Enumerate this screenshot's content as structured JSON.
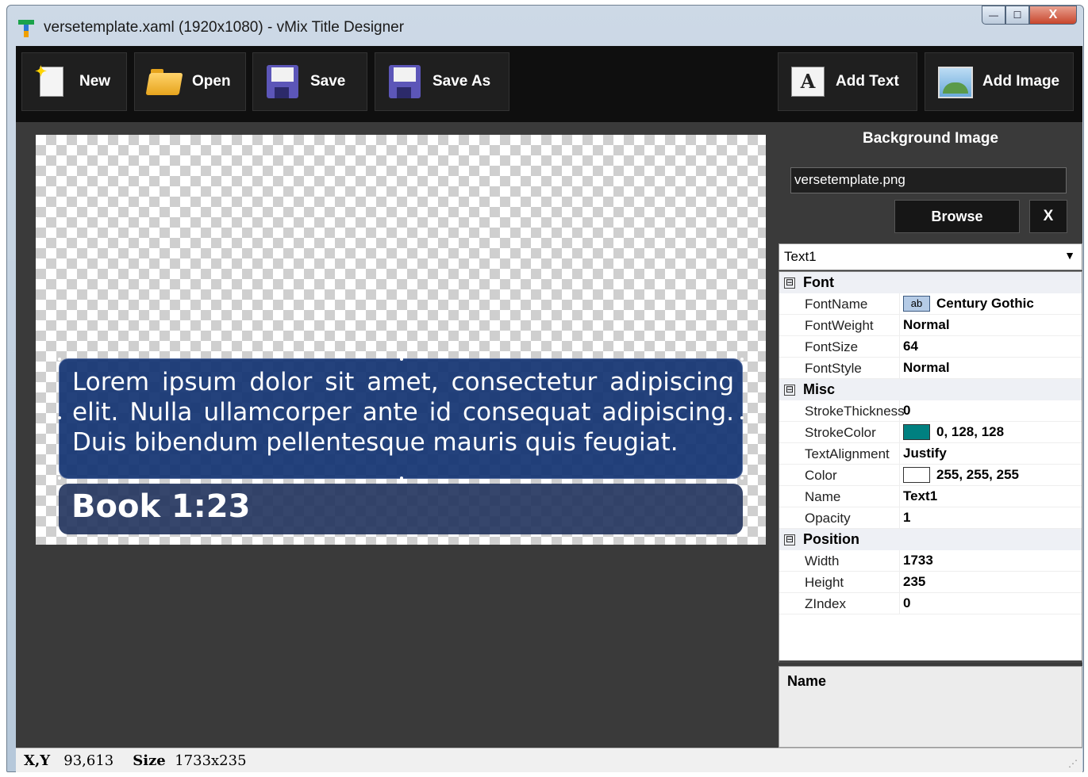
{
  "window": {
    "title": "versetemplate.xaml (1920x1080) - vMix Title Designer",
    "controls": {
      "minimize": "—",
      "maximize": "☐",
      "close": "X"
    }
  },
  "toolbar": {
    "new_label": "New",
    "open_label": "Open",
    "save_label": "Save",
    "save_as_label": "Save As",
    "add_text_label": "Add Text",
    "add_image_label": "Add Image"
  },
  "canvas": {
    "verse_text": "Lorem ipsum dolor sit amet, consectetur adipiscing elit. Nulla ullamcorper ante id consequat adipiscing. Duis bibendum pellentesque mauris quis feugiat.",
    "reference_text": "Book 1:23"
  },
  "background_panel": {
    "title": "Background Image",
    "file": "versetemplate.png",
    "browse_label": "Browse",
    "clear_label": "X"
  },
  "object_selector": {
    "selected": "Text1"
  },
  "properties": {
    "font": {
      "category": "Font",
      "toggle": "⊟",
      "rows": [
        {
          "key": "FontName",
          "value": "Century Gothic",
          "sample": "ab"
        },
        {
          "key": "FontWeight",
          "value": "Normal"
        },
        {
          "key": "FontSize",
          "value": "64"
        },
        {
          "key": "FontStyle",
          "value": "Normal"
        }
      ]
    },
    "misc": {
      "category": "Misc",
      "toggle": "⊟",
      "rows": [
        {
          "key": "StrokeThickness",
          "value": "0"
        },
        {
          "key": "StrokeColor",
          "value": "0, 128, 128",
          "swatch": "#008080"
        },
        {
          "key": "TextAlignment",
          "value": "Justify"
        },
        {
          "key": "Color",
          "value": "255, 255, 255",
          "swatch": "#ffffff"
        },
        {
          "key": "Name",
          "value": "Text1"
        },
        {
          "key": "Opacity",
          "value": "1"
        }
      ]
    },
    "position": {
      "category": "Position",
      "toggle": "⊟",
      "rows": [
        {
          "key": "Width",
          "value": "1733"
        },
        {
          "key": "Height",
          "value": "235"
        },
        {
          "key": "ZIndex",
          "value": "0"
        }
      ]
    }
  },
  "description": {
    "title": "Name"
  },
  "status": {
    "xy_label": "X,Y",
    "xy_value": "93,613",
    "size_label": "Size",
    "size_value": "1733x235"
  },
  "colors": {
    "verse_box": "#163674",
    "reference_box": "#20325c",
    "toolbar": "#0f0f0f",
    "workspace": "#3a3a3a"
  }
}
